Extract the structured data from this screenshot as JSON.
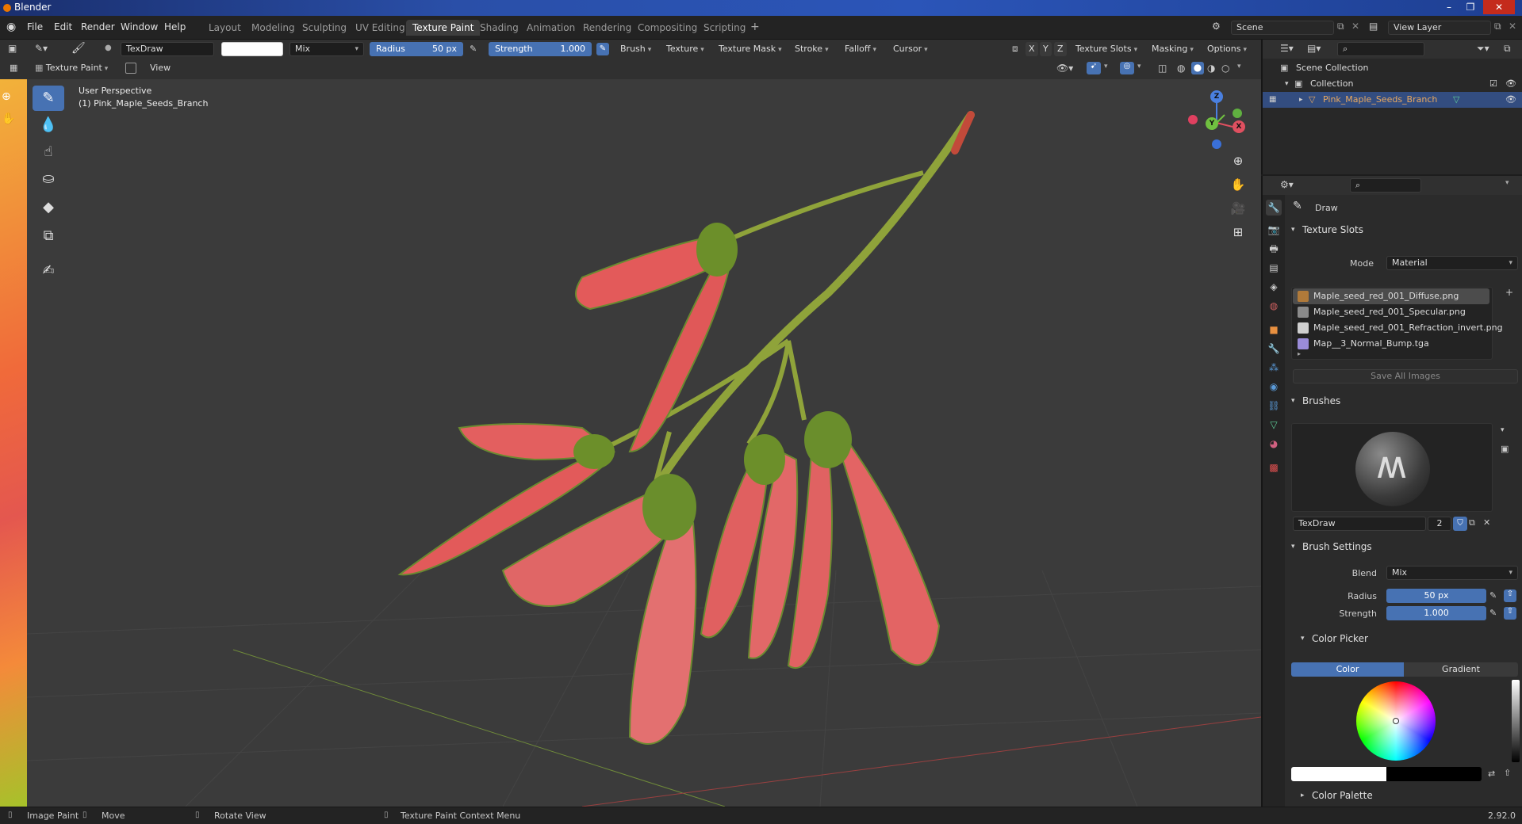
{
  "window": {
    "title": "Blender"
  },
  "menus": [
    "File",
    "Edit",
    "Render",
    "Window",
    "Help"
  ],
  "workspaces": [
    "Layout",
    "Modeling",
    "Sculpting",
    "UV Editing",
    "Texture Paint",
    "Shading",
    "Animation",
    "Rendering",
    "Compositing",
    "Scripting"
  ],
  "active_workspace": "Texture Paint",
  "scene": {
    "name": "Scene",
    "view_layer": "View Layer"
  },
  "tool_header": {
    "brush_name": "TexDraw",
    "blend": "Mix",
    "radius_label": "Radius",
    "radius_value": "50 px",
    "strength_label": "Strength",
    "strength_value": "1.000",
    "menus": [
      "Brush",
      "Texture",
      "Texture Mask",
      "Stroke",
      "Falloff",
      "Cursor"
    ],
    "axes": [
      "X",
      "Y",
      "Z"
    ],
    "right_menus": [
      "Texture Slots",
      "Masking",
      "Options"
    ]
  },
  "view_header": {
    "mode": "Texture Paint",
    "view": "View"
  },
  "viewport": {
    "overlay_line1": "User Perspective",
    "overlay_line2": "(1) Pink_Maple_Seeds_Branch"
  },
  "gizmo": {
    "x": "X",
    "y": "Y",
    "z": "Z"
  },
  "outliner": {
    "root": "Scene Collection",
    "collection": "Collection",
    "object": "Pink_Maple_Seeds_Branch"
  },
  "properties": {
    "tool_name": "Draw",
    "texture_slots": {
      "title": "Texture Slots",
      "mode_label": "Mode",
      "mode_value": "Material",
      "slots": [
        {
          "name": "Maple_seed_red_001_Diffuse.png",
          "color": "#b07a3a"
        },
        {
          "name": "Maple_seed_red_001_Specular.png",
          "color": "#8a8a8a"
        },
        {
          "name": "Maple_seed_red_001_Refraction_invert.png",
          "color": "#cfcfcf"
        },
        {
          "name": "Map__3_Normal_Bump.tga",
          "color": "#9a8cd8"
        }
      ],
      "save_all": "Save All Images"
    },
    "brushes": {
      "title": "Brushes",
      "brush_name": "TexDraw",
      "users": "2"
    },
    "brush_settings": {
      "title": "Brush Settings",
      "blend_label": "Blend",
      "blend_value": "Mix",
      "radius_label": "Radius",
      "radius_value": "50 px",
      "strength_label": "Strength",
      "strength_value": "1.000"
    },
    "color_picker": {
      "title": "Color Picker",
      "tab_color": "Color",
      "tab_gradient": "Gradient"
    },
    "color_palette": {
      "title": "Color Palette"
    }
  },
  "status": {
    "image_paint": "Image Paint",
    "move": "Move",
    "rotate": "Rotate View",
    "context": "Texture Paint Context Menu",
    "version": "2.92.0"
  },
  "colors": {
    "accent": "#4772b3",
    "selection": "#334d80",
    "object_name": "#e8a860"
  }
}
